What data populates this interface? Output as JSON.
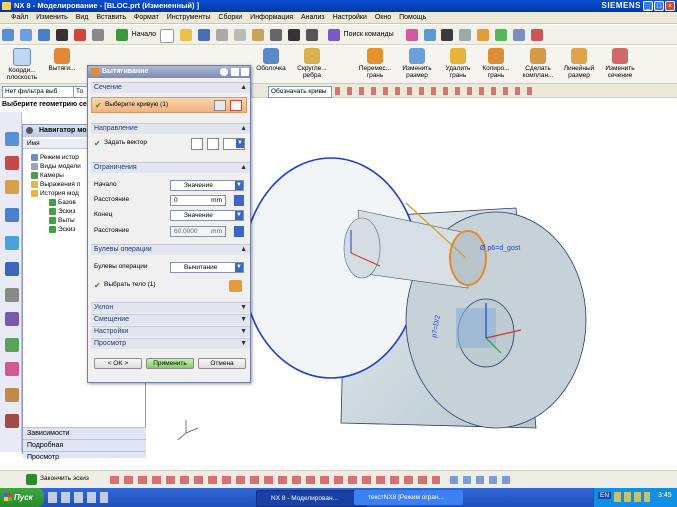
{
  "window": {
    "title": "NX 8 - Моделирование - [BLOC.prt (Измененный) ]",
    "brand": "SIEMENS",
    "controls": [
      "_",
      "□",
      "×"
    ]
  },
  "menu": [
    "Файл",
    "Изменить",
    "Вид",
    "Вставить",
    "Формат",
    "Инструменты",
    "Сборки",
    "Информация",
    "Анализ",
    "Настройки",
    "Окно",
    "Помощь"
  ],
  "toolbar": {
    "start_label": "Начало",
    "search_label": "Поиск команды"
  },
  "ribbon": [
    "Коорди... плоскость",
    "Вытяги...",
    "Оболочка",
    "Скругле... ребра",
    "Перемес... грань",
    "Изменить размер",
    "Удалить грань",
    "Копиро... грань",
    "Сделать комплан...",
    "Линейный размер",
    "Изменить сечение"
  ],
  "filterbar": {
    "filter": "Нет фильтра выб",
    "assembly": "То",
    "curve_rule": "Обозначать кривы"
  },
  "cue": "Выберите геометрию се",
  "navigator": {
    "title": "Навигатор мо",
    "column": "Имя",
    "items": [
      "Режим истор",
      "Виды модели",
      "Камеры",
      "Выражения п",
      "История мод",
      "Базов",
      "Эскиз",
      "Выты",
      "Эскиз"
    ],
    "footer": [
      "Зависимости",
      "Подробная",
      "Просмотр"
    ]
  },
  "dialog": {
    "title": "Вытягивание",
    "sections": {
      "section": "Сечение",
      "direction": "Направление",
      "limits": "Ограничения",
      "boolean": "Булевы операции",
      "draft": "Уклон",
      "offset": "Смещение",
      "settings": "Настройки",
      "preview": "Просмотр"
    },
    "select_curve": "Выберите кривую (1)",
    "vector": "Задать вектор",
    "start_label": "Начало",
    "start_value": "Значение",
    "dist1_label": "Расстояние",
    "dist1_value": "0",
    "dist1_unit": "mm",
    "end_label": "Конец",
    "end_value": "Значение",
    "dist2_label": "Расстояние",
    "dist2_value": "60.0000",
    "dist2_unit": "mm",
    "bool_label": "Булевы операции",
    "bool_value": "Вычитание",
    "select_body": "Выбрать тело (1)",
    "ok": "< OK >",
    "apply": "Применить",
    "cancel": "Отмена"
  },
  "graphics": {
    "dim1": "Ø p6=d_gost",
    "dim2": "p7=D/2"
  },
  "sketchbar": {
    "finish": "Закончить эскиз"
  },
  "taskbar": {
    "start": "Пуск",
    "tasks": [
      "NX 8 - Моделирован...",
      "текстNX8 [Режим огран..."
    ],
    "lang": "EN",
    "time": "3:45"
  }
}
